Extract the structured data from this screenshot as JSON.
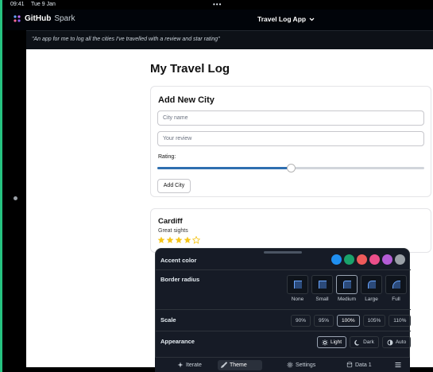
{
  "status_bar": {
    "time": "09:41",
    "date": "Tue 9 Jan",
    "dots": "•••"
  },
  "header": {
    "brand_bold": "GitHub",
    "brand_light": "Spark",
    "app_name": "Travel Log App"
  },
  "prompt": "\"An app for me to log all the cities I've travelled with a review and star rating\"",
  "main": {
    "title": "My Travel Log",
    "add_card": {
      "title": "Add New City",
      "city_placeholder": "City name",
      "review_placeholder": "Your review",
      "rating_label": "Rating:",
      "rating_fraction": 0.5,
      "add_button": "Add City"
    },
    "entries": [
      {
        "city": "Cardiff",
        "review": "Great sights",
        "stars": 4,
        "max_stars": 5
      }
    ]
  },
  "theme_panel": {
    "accent_label": "Accent color",
    "accent_colors": [
      "#1f8ff0",
      "#1aa36b",
      "#ee5a5a",
      "#ec4f8a",
      "#b45cd6",
      "#9aa0a6"
    ],
    "radius_label": "Border radius",
    "radius_options": [
      "None",
      "Small",
      "Medium",
      "Large",
      "Full"
    ],
    "radius_selected": "Medium",
    "scale_label": "Scale",
    "scale_options": [
      "90%",
      "95%",
      "100%",
      "105%",
      "110%"
    ],
    "scale_selected": "100%",
    "appearance_label": "Appearance",
    "appearance_options": [
      "Light",
      "Dark",
      "Auto"
    ],
    "appearance_selected": "Light"
  },
  "bottom_bar": {
    "iterate": "Iterate",
    "theme": "Theme",
    "settings": "Settings",
    "data": "Data 1",
    "active": "Theme"
  }
}
